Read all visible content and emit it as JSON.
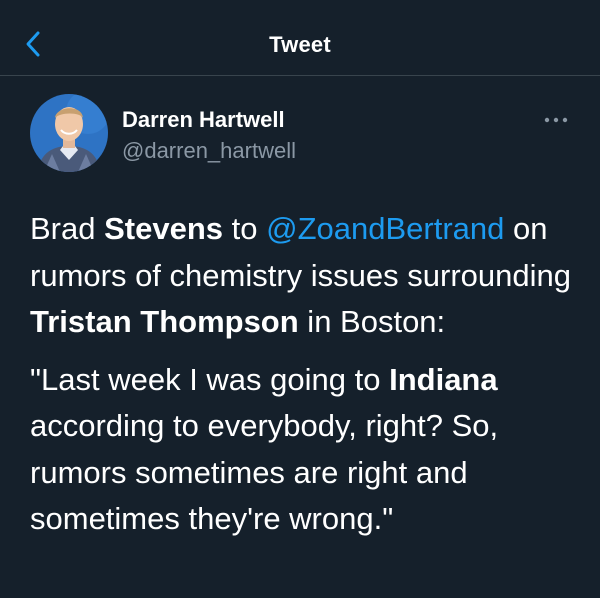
{
  "header": {
    "title": "Tweet",
    "back_icon": "chevron-left-icon"
  },
  "author": {
    "display_name": "Darren Hartwell",
    "handle": "@darren_hartwell",
    "more_icon": "ellipsis-icon"
  },
  "tweet": {
    "paragraph1": {
      "t1": "Brad ",
      "b1": "Stevens",
      "t2": " to ",
      "mention": "@ZoandBertrand",
      "t3": " on rumors of chemistry issues surrounding ",
      "b2": "Tristan Thompson",
      "t4": " in Boston:"
    },
    "paragraph2": {
      "t1": "\"Last week I was going to ",
      "b1": "Indiana",
      "t2": " according to everybody, right? So, rumors sometimes are right and sometimes they're wrong.\""
    }
  },
  "colors": {
    "background": "#15202b",
    "accent": "#1d9bf0",
    "secondary_text": "#8b98a5",
    "divider": "#38444d"
  }
}
